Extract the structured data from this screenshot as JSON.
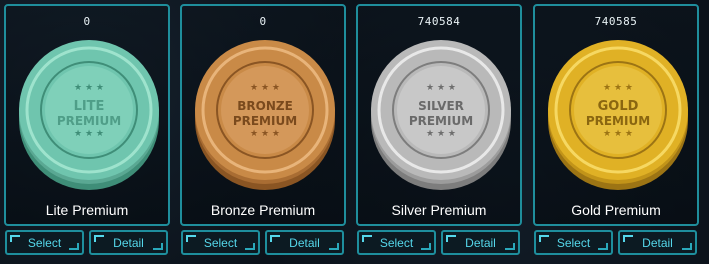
{
  "tiers": [
    {
      "count": "0",
      "coin_line1": "LITE",
      "coin_line2": "PREMIUM",
      "name": "Lite Premium",
      "select_label": "Select",
      "detail_label": "Detail",
      "colors": {
        "base": "#6fc5ae",
        "light": "#9ee3cd",
        "dark": "#3f8e78",
        "edge": "#5aa893"
      }
    },
    {
      "count": "0",
      "coin_line1": "BRONZE",
      "coin_line2": "PREMIUM",
      "name": "Bronze Premium",
      "select_label": "Select",
      "detail_label": "Detail",
      "colors": {
        "base": "#c98a47",
        "light": "#e8b47a",
        "dark": "#8a5523",
        "edge": "#a96d33"
      }
    },
    {
      "count": "740584",
      "coin_line1": "SILVER",
      "coin_line2": "PREMIUM",
      "name": "Silver Premium",
      "select_label": "Select",
      "detail_label": "Detail",
      "colors": {
        "base": "#b9b9b9",
        "light": "#e8e8e8",
        "dark": "#7d7d7d",
        "edge": "#9c9c9c"
      }
    },
    {
      "count": "740585",
      "coin_line1": "GOLD",
      "coin_line2": "PREMIUM",
      "name": "Gold Premium",
      "select_label": "Select",
      "detail_label": "Detail",
      "colors": {
        "base": "#e0b125",
        "light": "#f6d862",
        "dark": "#9c7414",
        "edge": "#c29419"
      }
    }
  ]
}
